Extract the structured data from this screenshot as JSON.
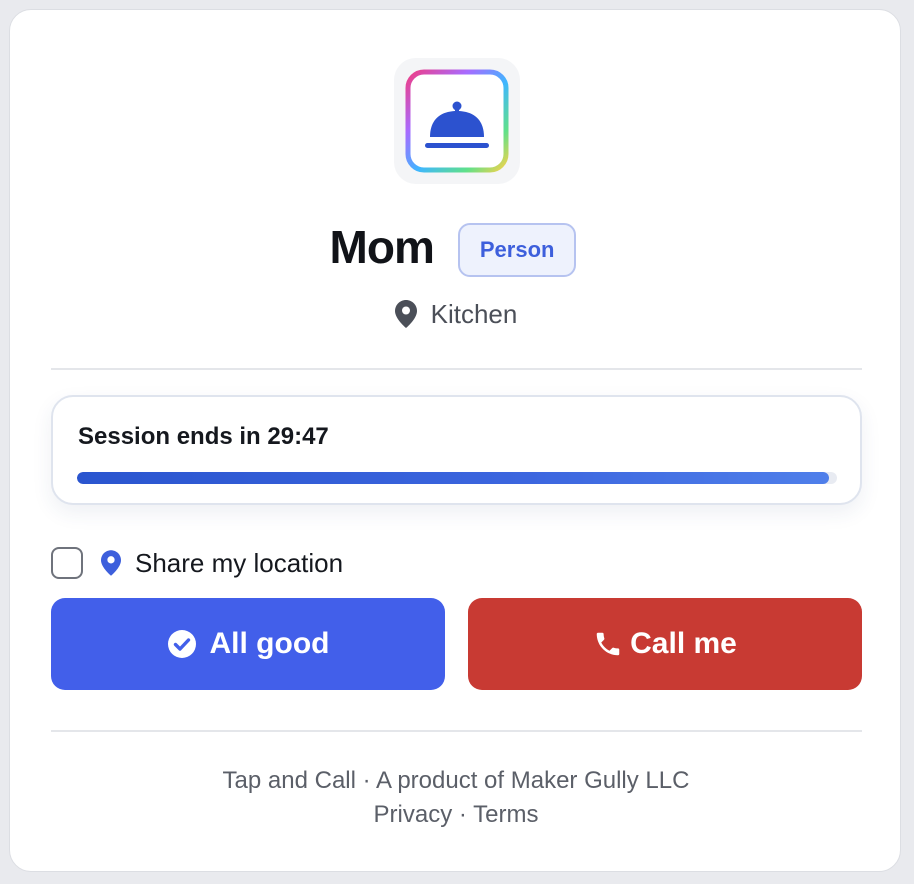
{
  "contact": {
    "name": "Mom",
    "type_badge": "Person",
    "location": "Kitchen"
  },
  "icons": {
    "app": "service-bell-icon",
    "location": "map-pin-icon",
    "check": "check-circle-icon",
    "phone": "phone-icon"
  },
  "session": {
    "label": "Session ends in 29:47",
    "remaining_fraction": 0.99
  },
  "share": {
    "label": "Share my location",
    "checked": false
  },
  "actions": {
    "good_label": "All good",
    "call_label": "Call me"
  },
  "footer": {
    "product": "Tap and Call",
    "separator": "·",
    "maker": "A product of Maker Gully LLC",
    "privacy": "Privacy",
    "terms": "Terms"
  },
  "colors": {
    "primary": "#425fea",
    "danger": "#c83a33",
    "badge_text": "#3d5fdc",
    "progress": "#2a55cf"
  }
}
